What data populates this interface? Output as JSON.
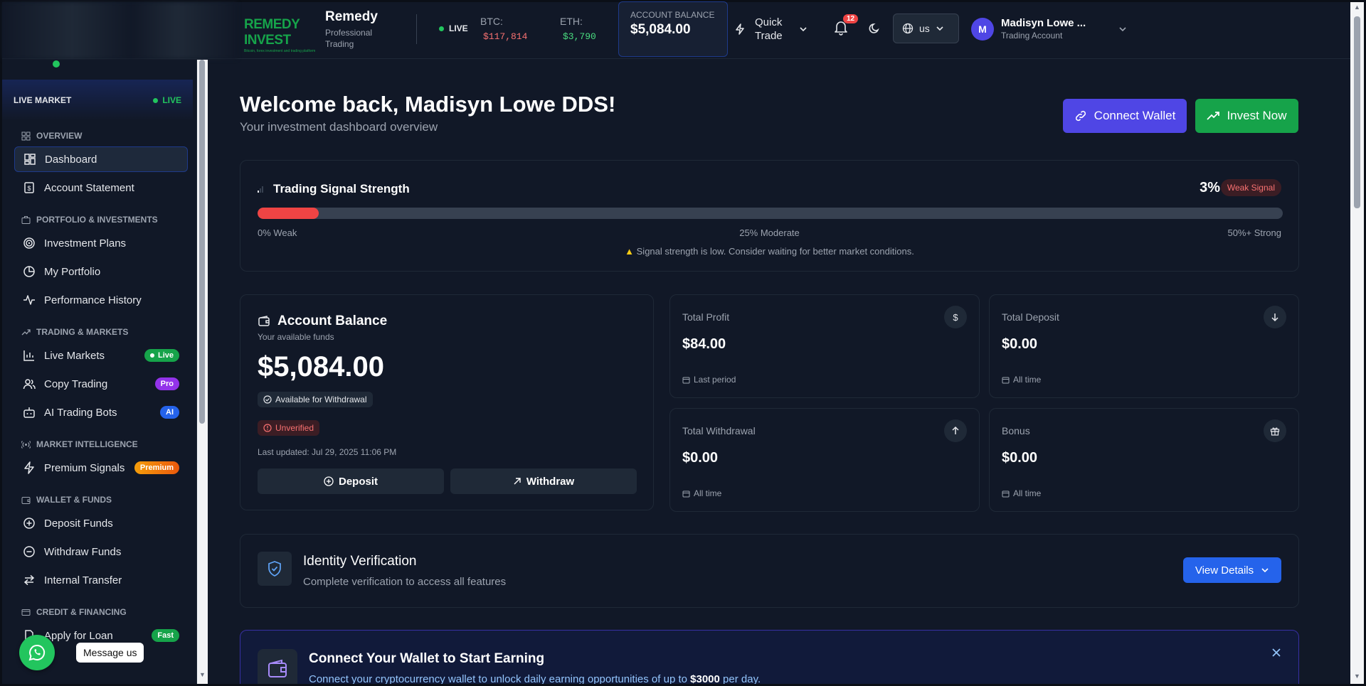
{
  "header": {
    "logo_text": "REMEDY INVEST",
    "logo_tagline": "Bitcoin, forex investment and trading platform",
    "brand_name": "Remedy",
    "brand_sub": "Professional Trading",
    "live_label": "LIVE",
    "btc_label": "BTC:",
    "btc_value": "$117,814",
    "eth_label": "ETH:",
    "eth_value": "$3,790",
    "balance_label": "ACCOUNT BALANCE",
    "balance_value": "$5,084.00",
    "quick_trade_label": "Quick Trade",
    "notification_count": "12",
    "language": "us",
    "user_initial": "M",
    "user_name": "Madisyn Lowe ...",
    "user_role": "Trading Account",
    "colors": {
      "btc": "#f87171",
      "eth": "#4ade80"
    }
  },
  "sidebar": {
    "live_market_title": "LIVE MARKET",
    "live_market_status": "LIVE",
    "sections": {
      "overview": "OVERVIEW",
      "portfolio": "PORTFOLIO & INVESTMENTS",
      "trading": "TRADING & MARKETS",
      "intelligence": "MARKET INTELLIGENCE",
      "wallet": "WALLET & FUNDS",
      "credit": "CREDIT & FINANCING"
    },
    "items": {
      "dashboard": "Dashboard",
      "account_statement": "Account Statement",
      "investment_plans": "Investment Plans",
      "my_portfolio": "My Portfolio",
      "performance_history": "Performance History",
      "live_markets": "Live Markets",
      "live_markets_tag": "Live",
      "copy_trading": "Copy Trading",
      "copy_trading_tag": "Pro",
      "ai_trading_bots": "AI Trading Bots",
      "ai_trading_bots_tag": "AI",
      "premium_signals": "Premium Signals",
      "premium_signals_tag": "Premium",
      "deposit_funds": "Deposit Funds",
      "withdraw_funds": "Withdraw Funds",
      "internal_transfer": "Internal Transfer",
      "apply_loan": "Apply for Loan",
      "apply_loan_tag": "Fast"
    }
  },
  "chat": {
    "label": "Message us"
  },
  "main": {
    "welcome_title": "Welcome back, Madisyn Lowe DDS!",
    "welcome_sub": "Your investment dashboard overview",
    "connect_wallet_label": "Connect Wallet",
    "invest_now_label": "Invest Now",
    "signal": {
      "title": "Trading Signal Strength",
      "percent_label": "3%",
      "strength_fraction": 0.03,
      "badge": "Weak Signal",
      "scale_low": "0% Weak",
      "scale_mid": "25% Moderate",
      "scale_high": "50%+ Strong",
      "warning": "Signal strength is low. Consider waiting for better market conditions."
    },
    "account": {
      "title": "Account Balance",
      "subtitle": "Your available funds",
      "value": "$5,084.00",
      "available_label": "Available for Withdrawal",
      "status": "Unverified",
      "updated": "Last updated: Jul 29, 2025 11:06 PM",
      "deposit_label": "Deposit",
      "withdraw_label": "Withdraw"
    },
    "stats": {
      "profit": {
        "label": "Total Profit",
        "value": "$84.00",
        "foot": "Last period"
      },
      "deposit": {
        "label": "Total Deposit",
        "value": "$0.00",
        "foot": "All time"
      },
      "withdrawal": {
        "label": "Total Withdrawal",
        "value": "$0.00",
        "foot": "All time"
      },
      "bonus": {
        "label": "Bonus",
        "value": "$0.00",
        "foot": "All time"
      }
    },
    "identity": {
      "title": "Identity Verification",
      "subtitle": "Complete verification to access all features",
      "button": "View Details"
    },
    "wallet_banner": {
      "title": "Connect Your Wallet to Start Earning",
      "text_before": "Connect your cryptocurrency wallet to unlock daily earning opportunities of up to",
      "amount": "$3000",
      "text_after": "per day."
    }
  }
}
